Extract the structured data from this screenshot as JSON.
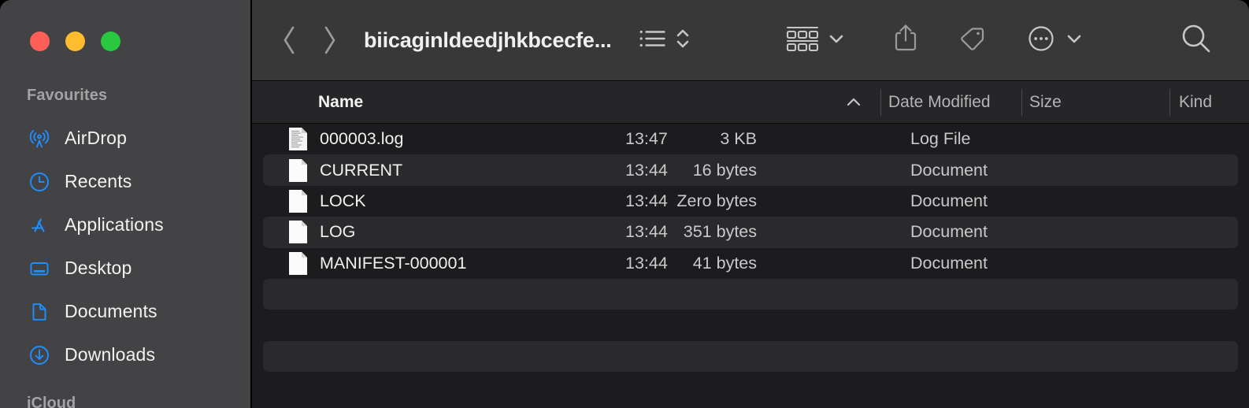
{
  "window": {
    "title": "biicaginldeedjhkbcecfe...",
    "traffic_lights": [
      {
        "name": "close",
        "color": "#ff5f57"
      },
      {
        "name": "minimize",
        "color": "#febc2e"
      },
      {
        "name": "maximize",
        "color": "#28c840"
      }
    ]
  },
  "sidebar": {
    "section_title": "Favourites",
    "section_title_2": "iCloud",
    "items": [
      {
        "label": "AirDrop",
        "icon": "airdrop-icon"
      },
      {
        "label": "Recents",
        "icon": "clock-icon"
      },
      {
        "label": "Applications",
        "icon": "app-store-icon"
      },
      {
        "label": "Desktop",
        "icon": "desktop-icon"
      },
      {
        "label": "Documents",
        "icon": "document-icon"
      },
      {
        "label": "Downloads",
        "icon": "download-icon"
      }
    ]
  },
  "toolbar": {
    "back_label": "Back",
    "forward_label": "Forward",
    "view_mode_label": "List View",
    "arrange_label": "Group By",
    "share_label": "Share",
    "tag_label": "Tags",
    "more_label": "More",
    "search_label": "Search"
  },
  "columns": [
    {
      "label": "Name",
      "sorted": true,
      "sort_direction": "ascending"
    },
    {
      "label": "Date Modified",
      "sorted": false
    },
    {
      "label": "Size",
      "sorted": false
    },
    {
      "label": "Kind",
      "sorted": false
    }
  ],
  "files": [
    {
      "name": "000003.log",
      "date_modified": "13:47",
      "size": "3 KB",
      "kind": "Log File",
      "icon": "text-document-icon"
    },
    {
      "name": "CURRENT",
      "date_modified": "13:44",
      "size": "16 bytes",
      "kind": "Document",
      "icon": "blank-document-icon"
    },
    {
      "name": "LOCK",
      "date_modified": "13:44",
      "size": "Zero bytes",
      "kind": "Document",
      "icon": "blank-document-icon"
    },
    {
      "name": "LOG",
      "date_modified": "13:44",
      "size": "351 bytes",
      "kind": "Document",
      "icon": "blank-document-icon"
    },
    {
      "name": "MANIFEST-000001",
      "date_modified": "13:44",
      "size": "41 bytes",
      "kind": "Document",
      "icon": "blank-document-icon"
    }
  ],
  "colors": {
    "sidebar_bg": "#434345",
    "toolbar_bg": "#383838",
    "list_bg": "#1c1c1e",
    "row_alt_bg": "#2a2a2c",
    "accent_blue": "#1e8fff",
    "header_bg": "#262628"
  }
}
